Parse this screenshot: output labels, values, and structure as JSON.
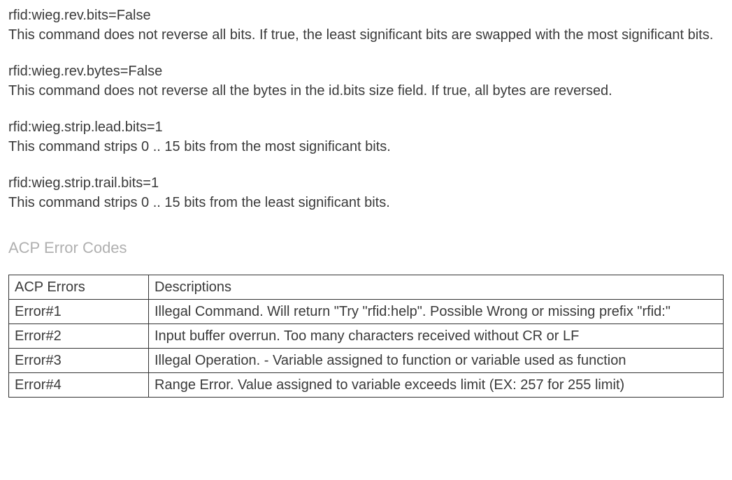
{
  "commands": [
    {
      "title": "rfid:wieg.rev.bits=False",
      "desc": "This command does not reverse all bits. If true, the least significant bits are swapped with the most significant bits."
    },
    {
      "title": "rfid:wieg.rev.bytes=False",
      "desc": "This command does not reverse all the bytes in the id.bits size field. If true, all bytes are reversed."
    },
    {
      "title": "rfid:wieg.strip.lead.bits=1",
      "desc": "This command strips 0 .. 15 bits from the most significant bits."
    },
    {
      "title": "rfid:wieg.strip.trail.bits=1",
      "desc": "This command strips 0 .. 15 bits from the least significant bits."
    }
  ],
  "section_title": "ACP Error Codes",
  "table": {
    "headers": [
      "ACP Errors",
      "Descriptions"
    ],
    "rows": [
      [
        "Error#1",
        "Illegal Command. Will return \"Try \"rfid:help\".  Possible Wrong or missing prefix \"rfid:\""
      ],
      [
        "Error#2",
        "Input buffer overrun. Too many characters received without CR or LF"
      ],
      [
        "Error#3",
        "Illegal Operation. - Variable assigned to function or variable used as function"
      ],
      [
        "Error#4",
        "Range Error. Value assigned to variable exceeds limit (EX: 257 for 255 limit)"
      ]
    ]
  }
}
